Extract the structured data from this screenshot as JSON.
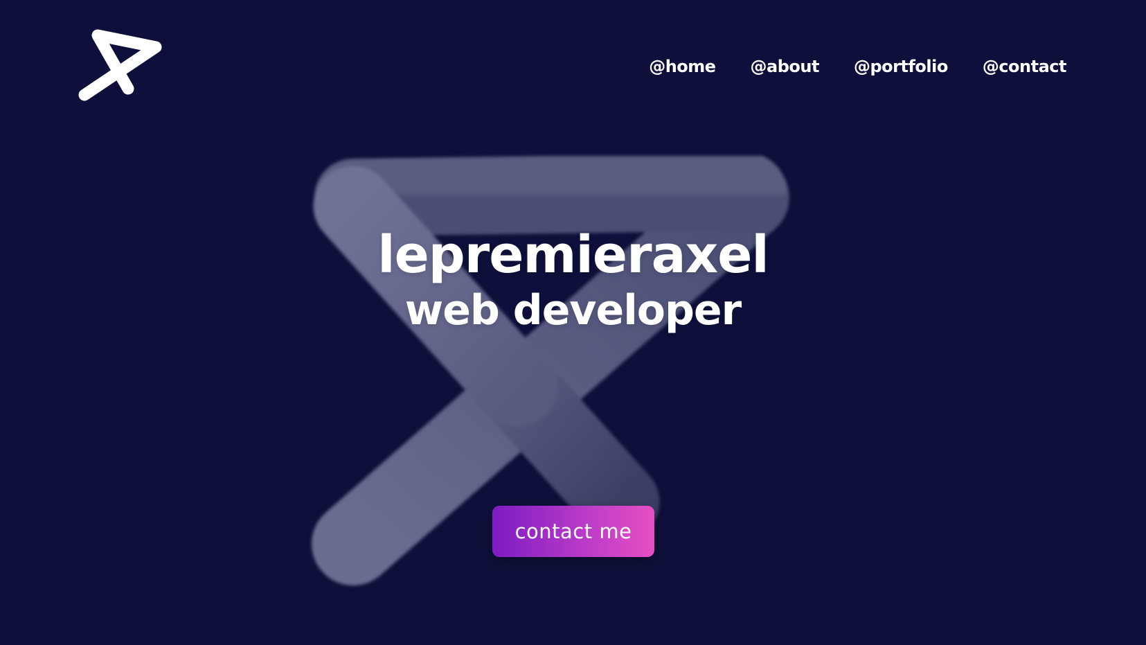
{
  "logo": {
    "icon": "axel-logo-icon",
    "color": "#ffffff"
  },
  "nav": {
    "items": [
      {
        "label": "@home"
      },
      {
        "label": "@about"
      },
      {
        "label": "@portfolio"
      },
      {
        "label": "@contact"
      }
    ]
  },
  "hero": {
    "name": "lepremieraxel",
    "role": "web developer",
    "graphic_icon": "3d-axel-logo-graphic"
  },
  "cta": {
    "label": "contact me"
  },
  "colors": {
    "background": "#0e103b",
    "text": "#ffffff",
    "graphic": "#5f6285",
    "cta_gradient_start": "#7d1cc2",
    "cta_gradient_end": "#e64fc3"
  }
}
